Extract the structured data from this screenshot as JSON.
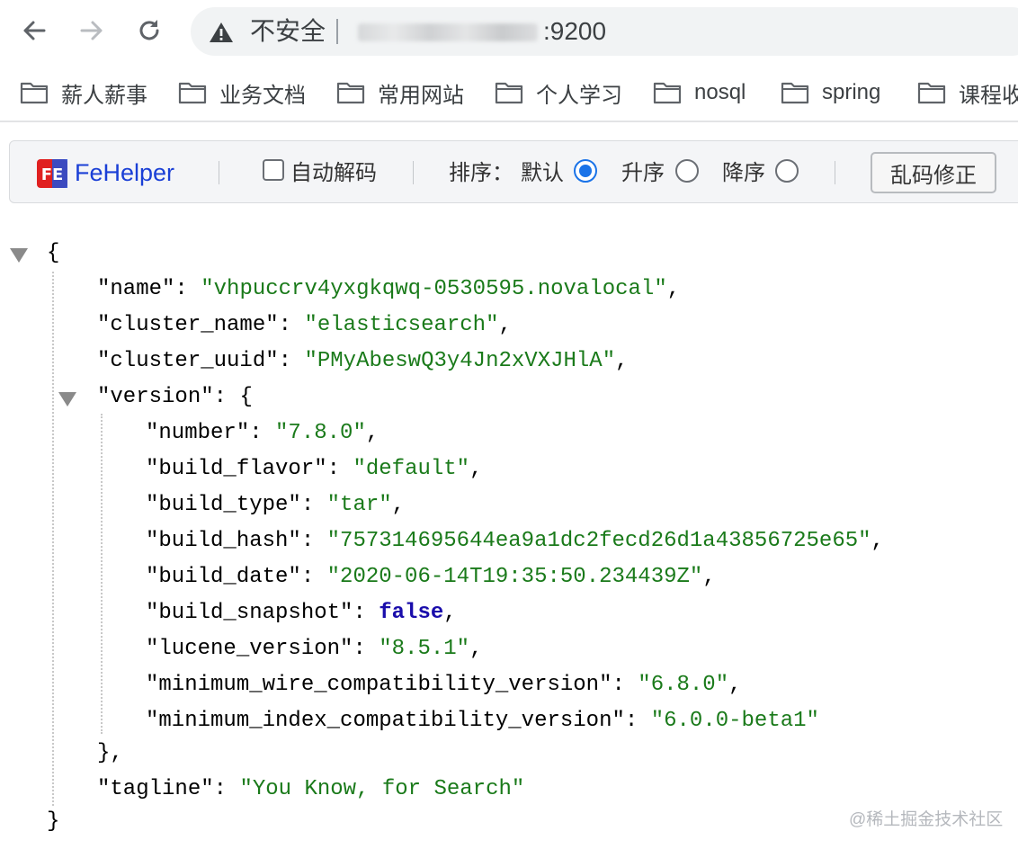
{
  "browser": {
    "back_icon": "arrow-left-icon",
    "forward_icon": "arrow-right-icon",
    "reload_icon": "reload-icon",
    "security_icon": "warning-triangle-icon",
    "security_text": "不安全",
    "url_port": ":9200"
  },
  "bookmarks": [
    {
      "label": "薪人薪事"
    },
    {
      "label": "业务文档"
    },
    {
      "label": "常用网站"
    },
    {
      "label": "个人学习"
    },
    {
      "label": "nosql"
    },
    {
      "label": "spring"
    },
    {
      "label": "课程收"
    }
  ],
  "fehelper": {
    "name": "FeHelper",
    "auto_decode_label": "自动解码",
    "sort_label": "排序：",
    "sort_options": [
      {
        "label": "默认",
        "checked": true
      },
      {
        "label": "升序",
        "checked": false
      },
      {
        "label": "降序",
        "checked": false
      }
    ],
    "fix_button": "乱码修正"
  },
  "json": {
    "open_brace": "{",
    "close_brace": "}",
    "name": {
      "key": "\"name\"",
      "value": "\"vhpuccrv4yxgkqwq-0530595.novalocal\""
    },
    "cluster_name": {
      "key": "\"cluster_name\"",
      "value": "\"elasticsearch\""
    },
    "cluster_uuid": {
      "key": "\"cluster_uuid\"",
      "value": "\"PMyAbeswQ3y4Jn2xVXJHlA\""
    },
    "version": {
      "key": "\"version\"",
      "open": "{",
      "close": "},",
      "number": {
        "key": "\"number\"",
        "value": "\"7.8.0\""
      },
      "build_flavor": {
        "key": "\"build_flavor\"",
        "value": "\"default\""
      },
      "build_type": {
        "key": "\"build_type\"",
        "value": "\"tar\""
      },
      "build_hash": {
        "key": "\"build_hash\"",
        "value": "\"757314695644ea9a1dc2fecd26d1a43856725e65\""
      },
      "build_date": {
        "key": "\"build_date\"",
        "value": "\"2020-06-14T19:35:50.234439Z\""
      },
      "build_snapshot": {
        "key": "\"build_snapshot\"",
        "value": "false"
      },
      "lucene_version": {
        "key": "\"lucene_version\"",
        "value": "\"8.5.1\""
      },
      "minimum_wire_compatibility_version": {
        "key": "\"minimum_wire_compatibility_version\"",
        "value": "\"6.8.0\""
      },
      "minimum_index_compatibility_version": {
        "key": "\"minimum_index_compatibility_version\"",
        "value": "\"6.0.0-beta1\""
      }
    },
    "tagline": {
      "key": "\"tagline\"",
      "value": "\"You Know, for Search\""
    }
  },
  "watermark": "@稀土掘金技术社区"
}
